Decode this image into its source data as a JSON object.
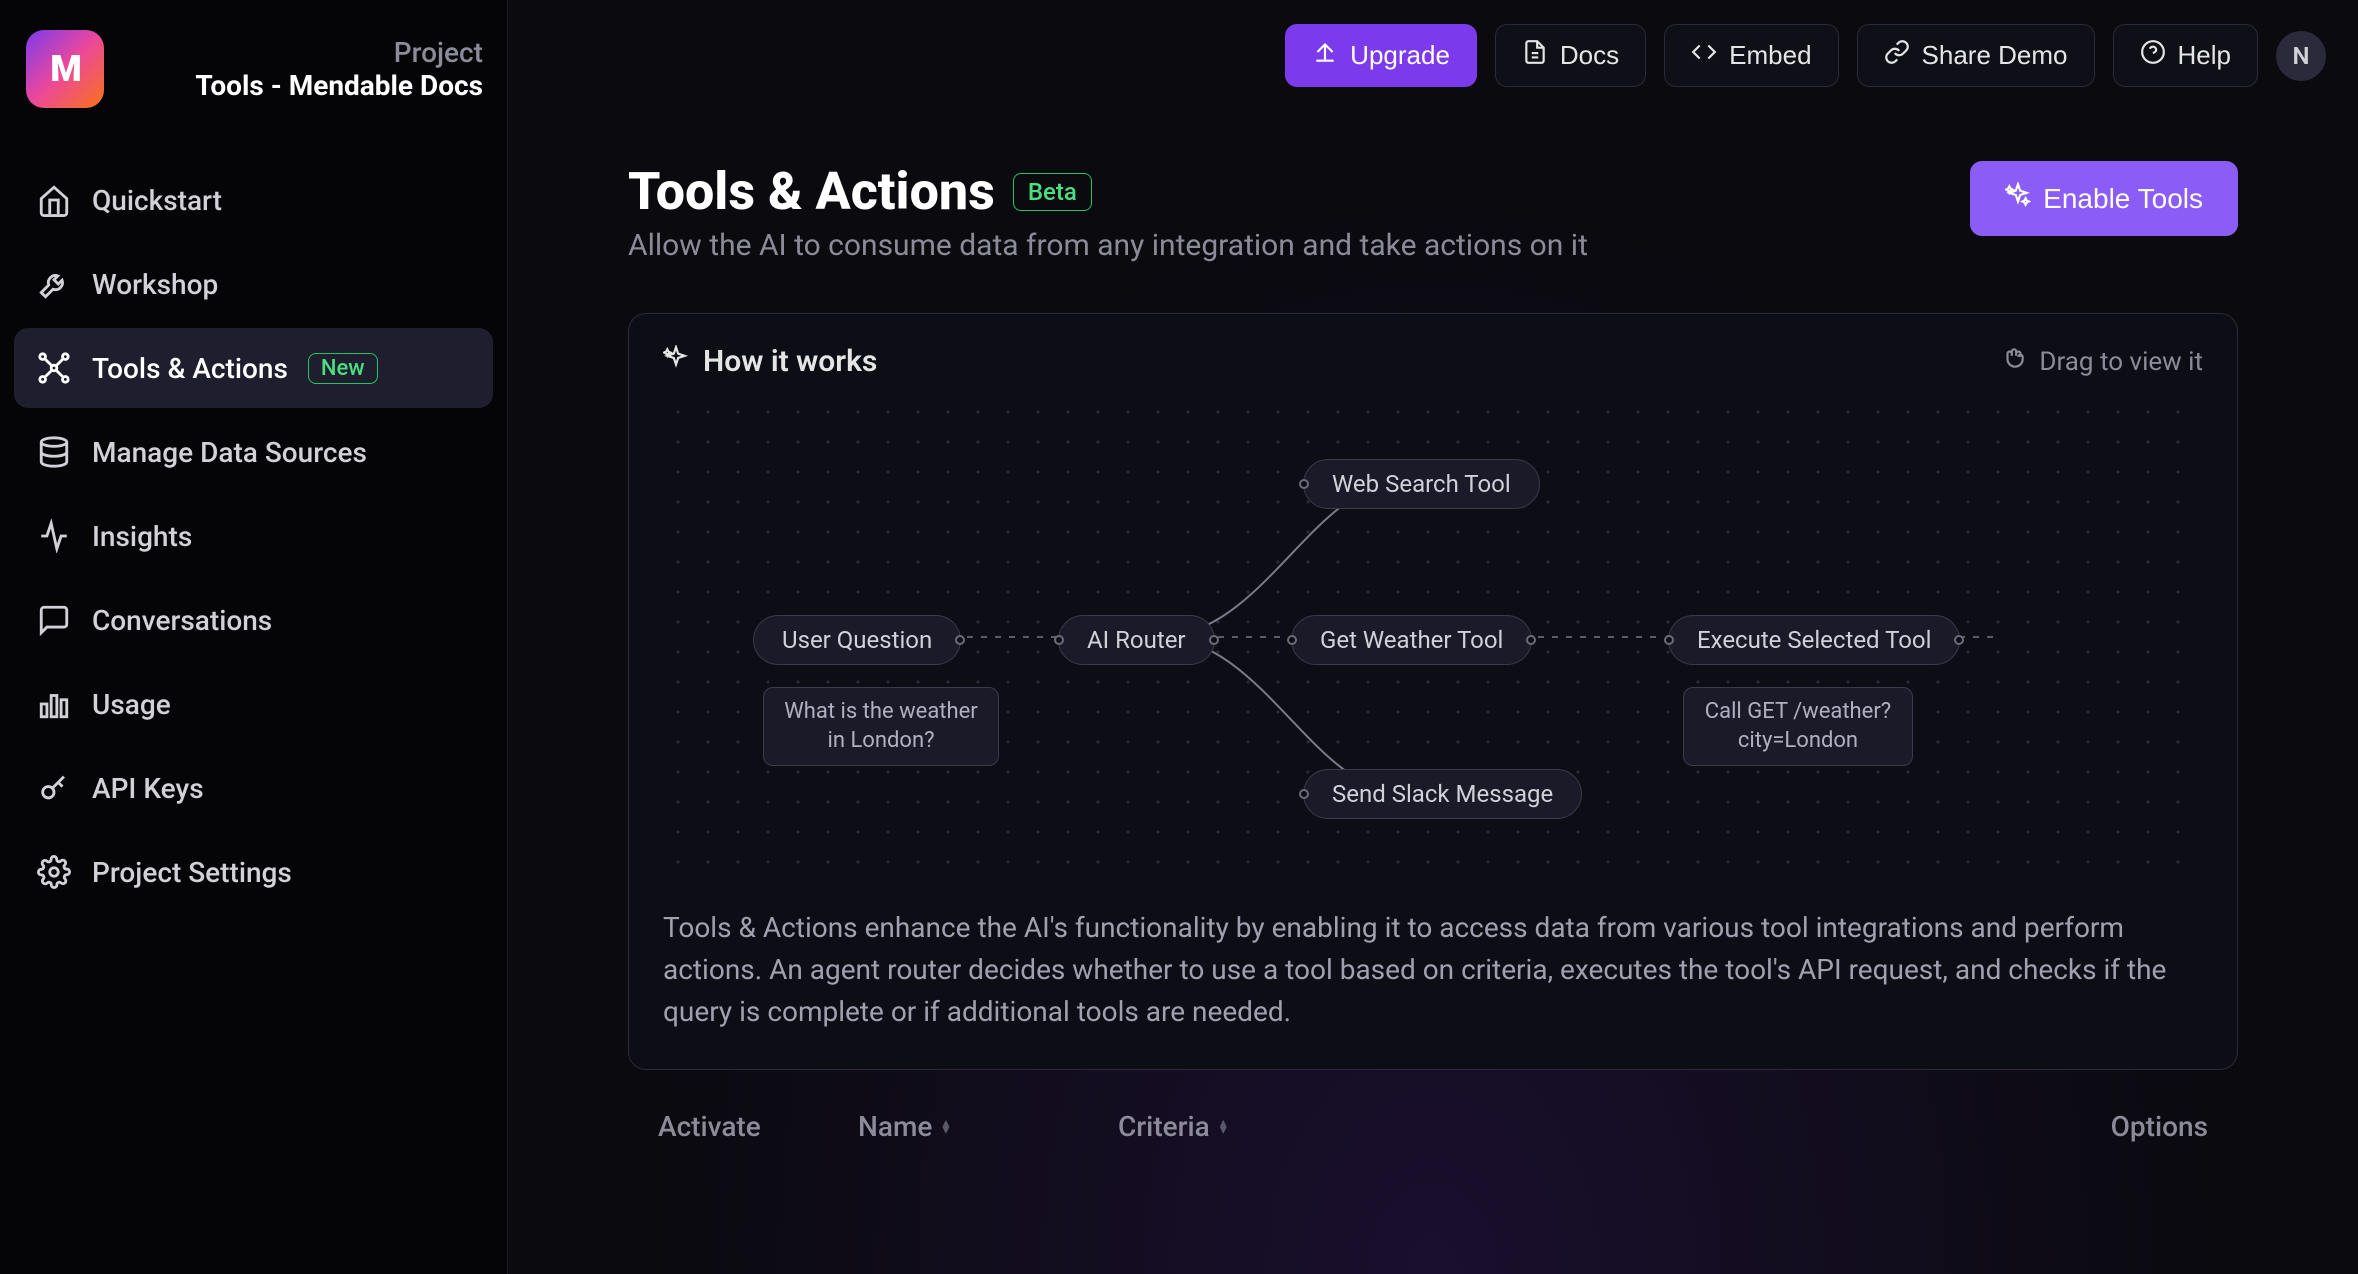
{
  "project": {
    "label": "Project",
    "name": "Tools - Mendable Docs"
  },
  "sidebar": {
    "items": [
      {
        "id": "quickstart",
        "label": "Quickstart",
        "icon": "home"
      },
      {
        "id": "workshop",
        "label": "Workshop",
        "icon": "wrench"
      },
      {
        "id": "tools-actions",
        "label": "Tools & Actions",
        "icon": "network",
        "badge": "New",
        "active": true
      },
      {
        "id": "manage-data",
        "label": "Manage Data Sources",
        "icon": "database"
      },
      {
        "id": "insights",
        "label": "Insights",
        "icon": "activity"
      },
      {
        "id": "conversations",
        "label": "Conversations",
        "icon": "chat"
      },
      {
        "id": "usage",
        "label": "Usage",
        "icon": "bars"
      },
      {
        "id": "api-keys",
        "label": "API Keys",
        "icon": "key"
      },
      {
        "id": "project-settings",
        "label": "Project Settings",
        "icon": "gear"
      }
    ]
  },
  "topbar": {
    "upgrade": "Upgrade",
    "docs": "Docs",
    "embed": "Embed",
    "share_demo": "Share Demo",
    "help": "Help",
    "avatar_initial": "N"
  },
  "page": {
    "title": "Tools & Actions",
    "badge": "Beta",
    "subtitle": "Allow the AI to consume data from any integration and take actions on it",
    "enable_button": "Enable Tools"
  },
  "how_it_works": {
    "title": "How it works",
    "drag_hint": "Drag to view it",
    "nodes": {
      "user_question": "User Question",
      "user_question_example": "What is the weather in London?",
      "ai_router": "AI Router",
      "web_search": "Web Search Tool",
      "get_weather": "Get Weather Tool",
      "send_slack": "Send Slack Message",
      "execute_tool": "Execute Selected Tool",
      "execute_example": "Call GET /weather?city=London"
    },
    "description": "Tools & Actions enhance the AI's functionality by enabling it to access data from various tool integrations and perform actions. An agent router decides whether to use a tool based on criteria, executes the tool's API request, and checks if the query is complete or if additional tools are needed."
  },
  "table": {
    "columns": {
      "activate": "Activate",
      "name": "Name",
      "criteria": "Criteria",
      "options": "Options"
    }
  }
}
